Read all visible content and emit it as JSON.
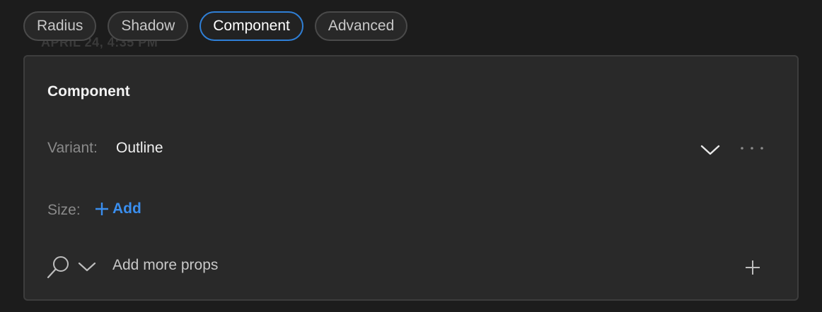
{
  "background": {
    "ghost_text": "APRIL 24, 4:35 PM"
  },
  "tabs": [
    {
      "label": "Radius",
      "active": false
    },
    {
      "label": "Shadow",
      "active": false
    },
    {
      "label": "Component",
      "active": true
    },
    {
      "label": "Advanced",
      "active": false
    }
  ],
  "panel": {
    "title": "Component",
    "variant": {
      "label": "Variant:",
      "value": "Outline"
    },
    "size": {
      "label": "Size:",
      "add_label": "Add"
    },
    "props": {
      "placeholder": "Add more props"
    }
  },
  "colors": {
    "accent": "#2f7fd6",
    "link": "#3a8eee",
    "panel_bg": "#292929",
    "page_bg": "#1c1c1c"
  },
  "icons": [
    "chevron-down-icon",
    "more-icon",
    "plus-icon",
    "search-icon"
  ]
}
